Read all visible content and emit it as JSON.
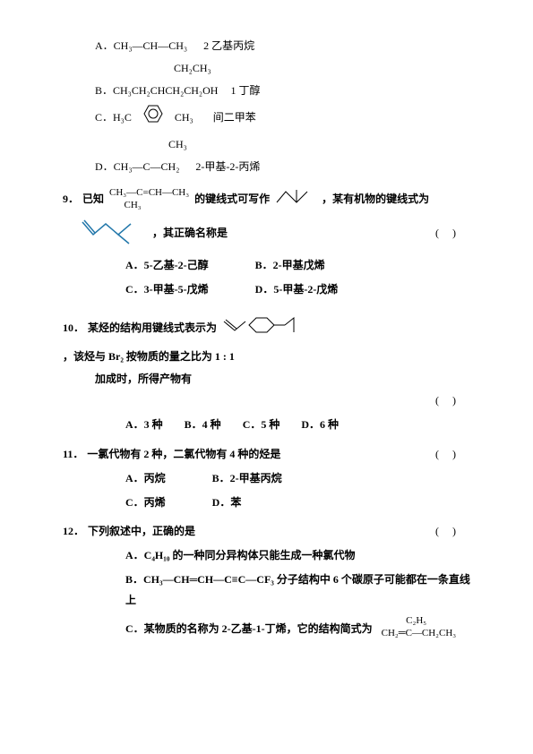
{
  "q8_options": {
    "A": {
      "prefix": "A．",
      "formula": "CH₃—CH—CH₃",
      "name": "2 乙基丙烷"
    },
    "B": {
      "prefix": "B．",
      "top": "CH₂CH₃",
      "formula": "CH₃CH₂CHCH₂CH₂OH",
      "name": "1 丁醇"
    },
    "C": {
      "prefix": "C．",
      "left": "H₃C",
      "right": "CH₃",
      "name": "间二甲苯"
    },
    "D": {
      "prefix": "D．",
      "top": "CH₃",
      "formula": "CH₃—C—CH₂",
      "name": "2-甲基-2-丙烯"
    }
  },
  "q9": {
    "num": "9．",
    "lead": "已知",
    "struct1_lines": [
      "CH₃—C=CH—CH₃",
      "      CH₃"
    ],
    "mid1": "的键线式可写作",
    "mid2": "，某有机物的键线式为",
    "tail": "，其正确名称是",
    "paren": "(    )",
    "options": {
      "A": "A．5-乙基-2-己醇",
      "B": "B．2-甲基戊烯",
      "C": "C．3-甲基-5-戊烯",
      "D": "D．5-甲基-2-戊烯"
    }
  },
  "q10": {
    "num": "10．",
    "lead": "某烃的结构用键线式表示为",
    "mid": "，该烃与 Br₂ 按物质的量之比为 1 : 1",
    "line2": "加成时，所得产物有",
    "paren": "(    )",
    "options": {
      "A": "A．3 种",
      "B": "B．4 种",
      "C": "C．5 种",
      "D": "D．6 种"
    }
  },
  "q11": {
    "num": "11．",
    "text": "一氯代物有 2 种，二氯代物有 4 种的烃是",
    "paren": "(    )",
    "options": {
      "A": "A．丙烷",
      "B": "B．2-甲基丙烷",
      "C": "C．丙烯",
      "D": "D．苯"
    }
  },
  "q12": {
    "num": "12．",
    "text": "下列叙述中，正确的是",
    "paren": "(    )",
    "A": "A．C₄H₁₀ 的一种同分异构体只能生成一种氯代物",
    "B": "B．CH₃—CH═CH—C≡C—CF₃ 分子结构中 6 个碳原子可能都在一条直线上",
    "C_pre": "C．某物质的名称为 2-乙基-1-丁烯，它的结构简式为",
    "C_lines": [
      "          C₂H₅",
      "CH₂═C—CH₂CH₃"
    ]
  }
}
